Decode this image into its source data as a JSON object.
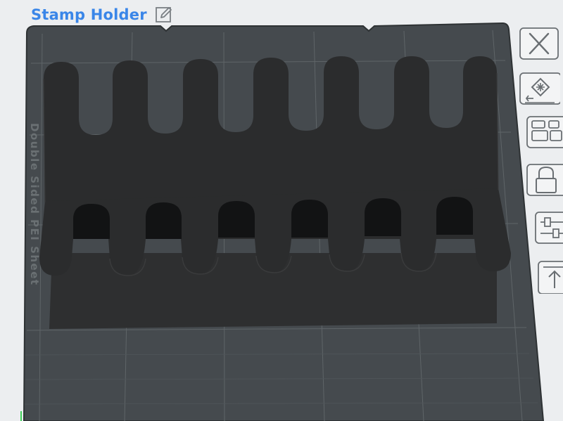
{
  "header": {
    "title": "Stamp Holder",
    "edit_icon": "pencil-edit-icon"
  },
  "bed": {
    "side_label": "Double Sided PEI Sheet"
  },
  "toolbar": {
    "tools": [
      {
        "name": "close-tool-button",
        "icon": "close-x-icon"
      },
      {
        "name": "place-on-face-button",
        "icon": "place-face-icon"
      },
      {
        "name": "arrange-button",
        "icon": "arrange-icon"
      },
      {
        "name": "lock-button",
        "icon": "lock-icon"
      },
      {
        "name": "adjust-button",
        "icon": "sliders-icon"
      },
      {
        "name": "export-button",
        "icon": "export-icon"
      }
    ]
  },
  "colors": {
    "title": "#3a86e8",
    "bed": "#454a4e",
    "model": "#2c2d2e",
    "grid": "#5f6568",
    "background": "#eceef0"
  }
}
